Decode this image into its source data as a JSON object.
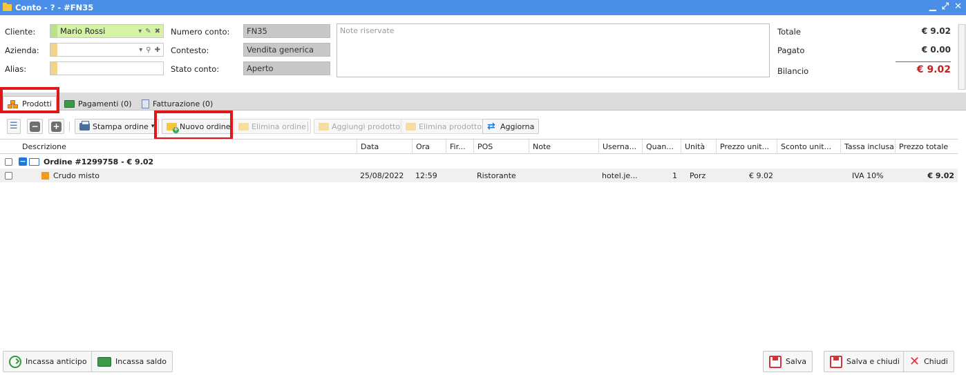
{
  "window": {
    "title": "Conto - ? - #FN35",
    "icon": "folder-icon",
    "controls": [
      "minimize-icon",
      "maximize-icon",
      "close-icon"
    ]
  },
  "form": {
    "cliente_label": "Cliente:",
    "cliente_value": "Mario Rossi",
    "azienda_label": "Azienda:",
    "azienda_value": "",
    "alias_label": "Alias:",
    "alias_value": "",
    "numero_label": "Numero conto:",
    "numero_value": "FN35",
    "contesto_label": "Contesto:",
    "contesto_value": "Vendita generica",
    "stato_label": "Stato conto:",
    "stato_value": "Aperto",
    "notes_placeholder": "Note riservate"
  },
  "totals": {
    "totale_label": "Totale",
    "totale_value": "€ 9.02",
    "pagato_label": "Pagato",
    "pagato_value": "€ 0.00",
    "bilancio_label": "Bilancio",
    "bilancio_value": "€ 9.02",
    "bilancio_color": "#c81e1e"
  },
  "tabs": [
    {
      "label": "Prodotti",
      "active": true
    },
    {
      "label": "Pagamenti (0)",
      "active": false
    },
    {
      "label": "Fatturazione (0)",
      "active": false
    }
  ],
  "toolbar": {
    "stampa": "Stampa ordine",
    "nuovo": "Nuovo ordine",
    "elimina_ordine": "Elimina ordine",
    "aggiungi": "Aggiungi prodotto",
    "elimina_prodotto": "Elimina prodotto",
    "aggiorna": "Aggiorna"
  },
  "grid": {
    "columns": [
      "Descrizione",
      "Data",
      "Ora",
      "Fir...",
      "POS",
      "Note",
      "Userna...",
      "Quan...",
      "Unità",
      "Prezzo unit...",
      "Sconto unit...",
      "Tassa inclusa",
      "Prezzo totale"
    ],
    "group": {
      "label": "Ordine #1299758 - € 9.02"
    },
    "rows": [
      {
        "descrizione": "Crudo misto",
        "data": "25/08/2022",
        "ora": "12:59",
        "fir": "",
        "pos": "Ristorante",
        "note": "",
        "username": "hotel.je...",
        "quantita": "1",
        "unita": "Porz",
        "prezzo_unit": "€ 9.02",
        "sconto_unit": "",
        "tassa": "IVA 10%",
        "prezzo_totale": "€ 9.02"
      }
    ]
  },
  "bottom": {
    "anticipo": "Incassa anticipo",
    "saldo": "Incassa saldo",
    "salva": "Salva",
    "salva_chiudi": "Salva e chiudi",
    "chiudi": "Chiudi"
  },
  "colors": {
    "titlebar": "#4b8ee8",
    "highlight": "#e0161a",
    "cliente_bg": "#d4f3a4"
  }
}
